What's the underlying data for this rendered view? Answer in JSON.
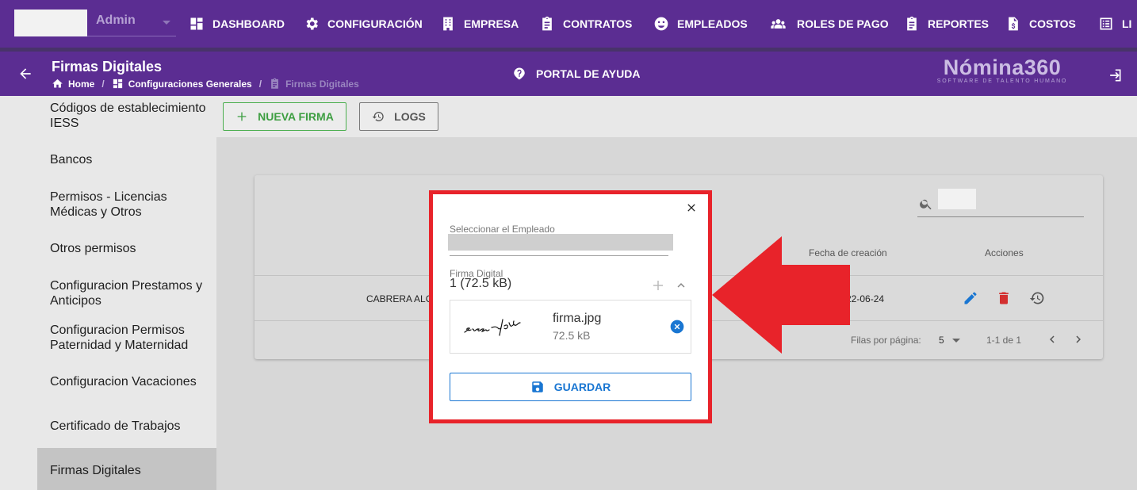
{
  "user": {
    "role": "Admin"
  },
  "nav": [
    {
      "label": "DASHBOARD",
      "icon": "dashboard-icon"
    },
    {
      "label": "CONFIGURACIÓN",
      "icon": "gear-icon"
    },
    {
      "label": "EMPRESA",
      "icon": "building-icon"
    },
    {
      "label": "CONTRATOS",
      "icon": "clipboard-icon"
    },
    {
      "label": "EMPLEADOS",
      "icon": "face-icon"
    },
    {
      "label": "ROLES DE PAGO",
      "icon": "group-icon"
    },
    {
      "label": "REPORTES",
      "icon": "clipboard-icon"
    },
    {
      "label": "COSTOS",
      "icon": "file-dollar-icon"
    },
    {
      "label": "LI",
      "icon": "list-icon"
    }
  ],
  "header": {
    "title": "Firmas Digitales",
    "breadcrumb": [
      "Home",
      "Configuraciones Generales",
      "Firmas Digitales"
    ],
    "help": "PORTAL DE AYUDA",
    "brand_name": "Nómina360",
    "brand_tagline": "SOFTWARE DE TALENTO HUMANO"
  },
  "sidebar": {
    "items": [
      "Códigos de establecimiento IESS",
      "Bancos",
      "Permisos - Licencias Médicas y Otros",
      "Otros permisos",
      "Configuracion Prestamos y Anticipos",
      "Configuracion Permisos Paternidad y Maternidad",
      "Configuracion Vacaciones",
      "Certificado de Trabajos",
      "Firmas Digitales"
    ],
    "active": "Firmas Digitales"
  },
  "toolbar": {
    "new_label": "NUEVA FIRMA",
    "logs_label": "LOGS"
  },
  "table": {
    "headers": {
      "fecha": "Fecha de creación",
      "acciones": "Acciones"
    },
    "rows": [
      {
        "nombre": "CABRERA ALC",
        "fecha": "22-06-24"
      }
    ],
    "footer": {
      "rows_per_page_label": "Filas por página:",
      "rows_per_page": "5",
      "range": "1-1 de 1"
    }
  },
  "modal": {
    "employee_label": "Seleccionar el Empleado",
    "signature_label": "Firma Digital",
    "file_count": "1 (72.5 kB)",
    "file_name": "firma.jpg",
    "file_size": "72.5 kB",
    "save_label": "GUARDAR"
  },
  "colors": {
    "primary": "#5b2d92",
    "highlight": "#e8232a",
    "accent_blue": "#1976d2",
    "accent_green": "#4caf50"
  }
}
